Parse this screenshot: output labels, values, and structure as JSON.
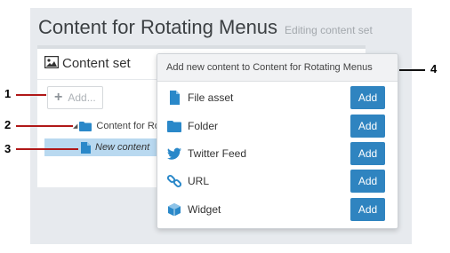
{
  "page": {
    "title": "Content for Rotating Menus",
    "subtitle": "Editing content set"
  },
  "card": {
    "title": "Content set",
    "add_label": "Add...",
    "tree": [
      {
        "label": "Content for Rotatin",
        "icon": "folder-icon"
      },
      {
        "label": "New content",
        "icon": "file-icon"
      }
    ]
  },
  "popover": {
    "title": "Add new content to Content for Rotating Menus",
    "items": [
      {
        "label": "File asset",
        "icon": "file-icon",
        "button": "Add"
      },
      {
        "label": "Folder",
        "icon": "folder-icon",
        "button": "Add"
      },
      {
        "label": "Twitter Feed",
        "icon": "twitter-icon",
        "button": "Add"
      },
      {
        "label": "URL",
        "icon": "link-icon",
        "button": "Add"
      },
      {
        "label": "Widget",
        "icon": "cube-icon",
        "button": "Add"
      }
    ]
  },
  "callouts": [
    "1",
    "2",
    "3",
    "4"
  ],
  "colors": {
    "accent": "#2f84c0",
    "icon_blue": "#2a88c9",
    "selection": "#b9d9f0",
    "callout_line": "#b01818"
  }
}
